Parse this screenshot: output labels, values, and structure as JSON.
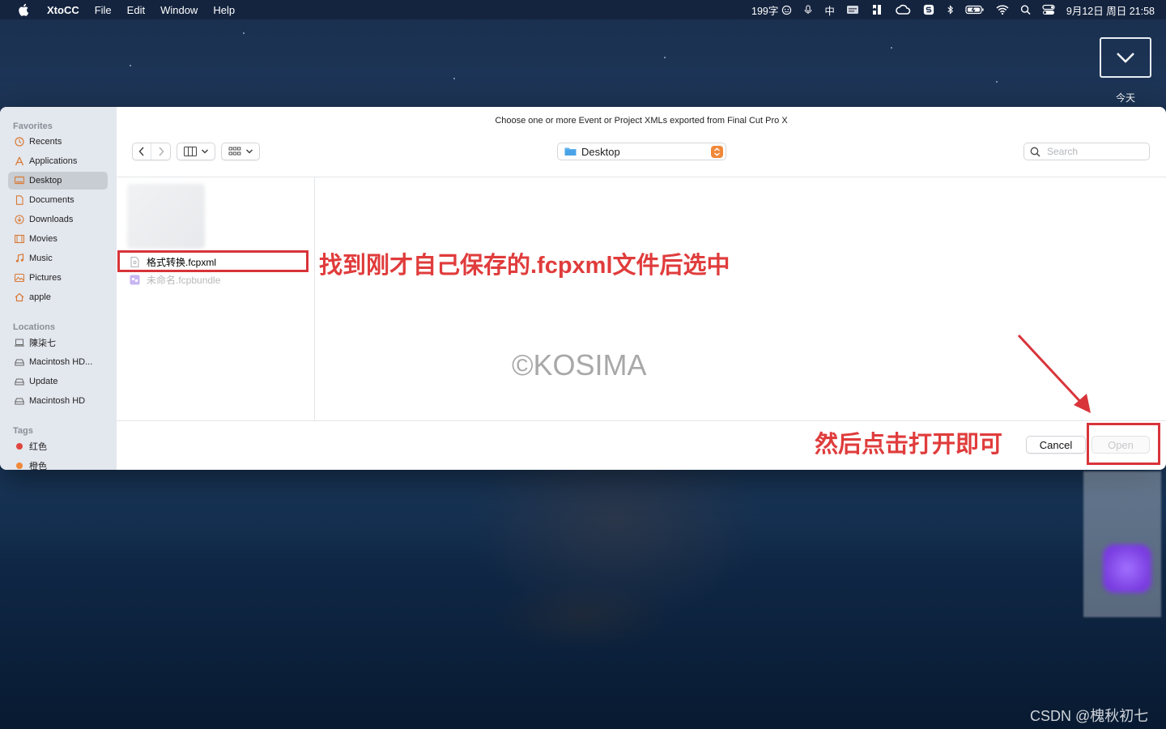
{
  "menubar": {
    "app_name": "XtoCC",
    "menus": [
      "File",
      "Edit",
      "Window",
      "Help"
    ],
    "word_count": "199字",
    "input_method": "中",
    "datetime": "9月12日 周日 21:58"
  },
  "today_widget": {
    "label": "今天"
  },
  "dialog": {
    "title": "Choose one or more Event or Project XMLs exported from Final Cut Pro X",
    "location": "Desktop",
    "search_placeholder": "Search",
    "cancel_label": "Cancel",
    "open_label": "Open"
  },
  "sidebar": {
    "favorites_title": "Favorites",
    "favorites": [
      {
        "label": "Recents",
        "icon": "clock-icon"
      },
      {
        "label": "Applications",
        "icon": "applications-icon"
      },
      {
        "label": "Desktop",
        "icon": "desktop-icon",
        "selected": true
      },
      {
        "label": "Documents",
        "icon": "document-icon"
      },
      {
        "label": "Downloads",
        "icon": "download-icon"
      },
      {
        "label": "Movies",
        "icon": "film-icon"
      },
      {
        "label": "Music",
        "icon": "music-icon"
      },
      {
        "label": "Pictures",
        "icon": "picture-icon"
      },
      {
        "label": "apple",
        "icon": "home-icon"
      }
    ],
    "locations_title": "Locations",
    "locations": [
      {
        "label": "陳柒七",
        "icon": "laptop-icon"
      },
      {
        "label": "Macintosh HD...",
        "icon": "disk-icon"
      },
      {
        "label": "Update",
        "icon": "disk-icon"
      },
      {
        "label": "Macintosh HD",
        "icon": "disk-icon"
      }
    ],
    "tags_title": "Tags",
    "tags": [
      {
        "label": "红色",
        "color": "#e0453e"
      },
      {
        "label": "橙色",
        "color": "#f0883a"
      }
    ]
  },
  "files": [
    {
      "name": "格式转换.fcpxml",
      "enabled": true
    },
    {
      "name": "未命名.fcpbundle",
      "enabled": false
    }
  ],
  "annotations": {
    "select_hint": "找到刚才自己保存的.fcpxml文件后选中",
    "open_hint": "然后点击打开即可"
  },
  "watermark": "©KOSIMA",
  "credit": "CSDN @槐秋初七",
  "colors": {
    "annotation_red": "#d8343a",
    "stepper_orange": "#f0883a",
    "sidebar_bg": "#e3e7ee"
  }
}
